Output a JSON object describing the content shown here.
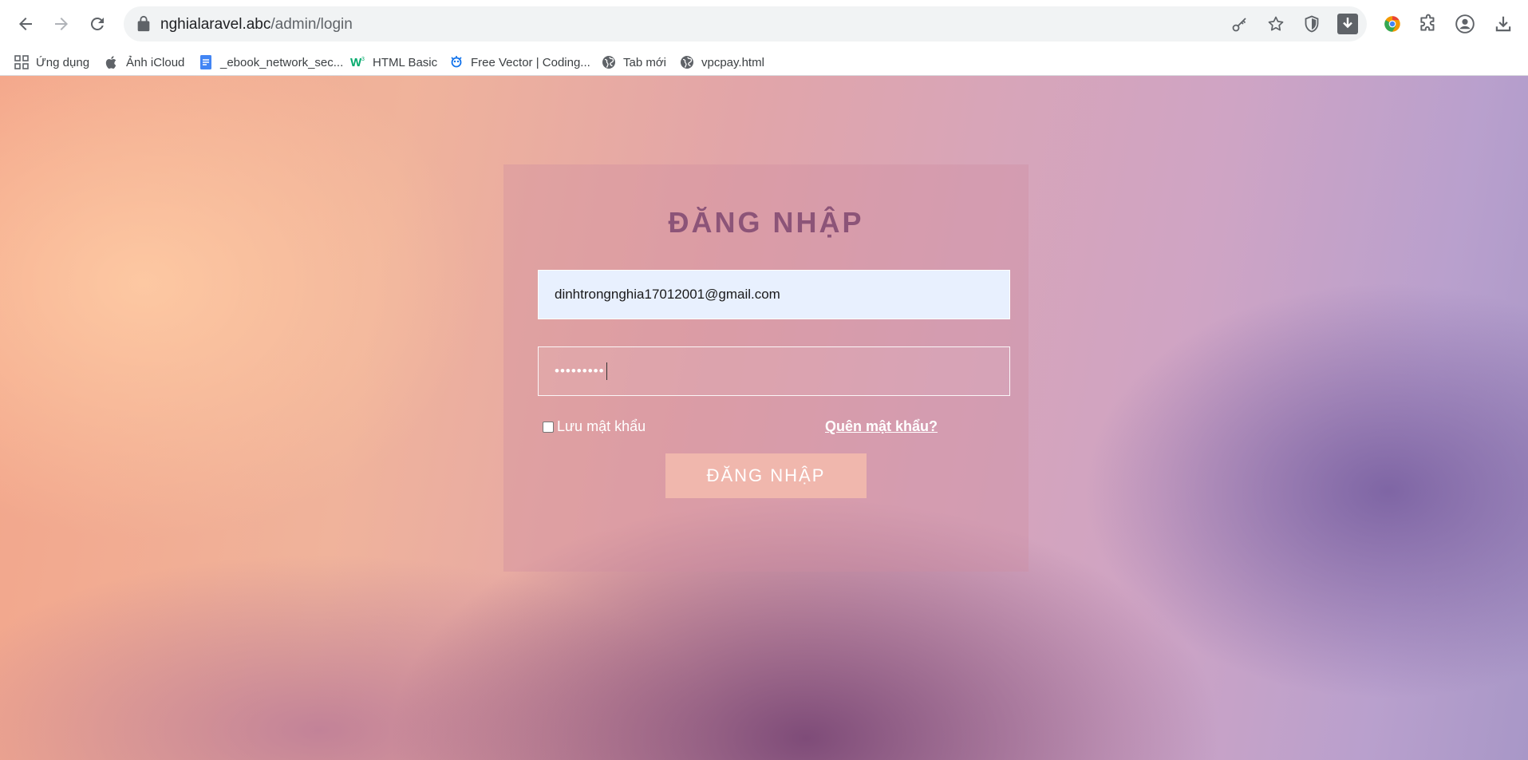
{
  "browser": {
    "url_host": "nghialaravel.abc",
    "url_path": "/admin/login"
  },
  "bookmarks": [
    {
      "label": "Ứng dụng"
    },
    {
      "label": "Ảnh iCloud"
    },
    {
      "label": "_ebook_network_sec..."
    },
    {
      "label": "HTML Basic"
    },
    {
      "label": "Free Vector | Coding..."
    },
    {
      "label": "Tab mới"
    },
    {
      "label": "vpcpay.html"
    }
  ],
  "login": {
    "title": "ĐĂNG NHẬP",
    "email_value": "dinhtrongnghia17012001@gmail.com",
    "password_mask": "•••••••••",
    "remember_label": "Lưu mật khẩu",
    "forgot_label": "Quên mật khẩu?",
    "submit_label": "ĐĂNG NHẬP"
  },
  "colors": {
    "title": "#8c5478",
    "submit_bg": "#f0b7ad",
    "email_bg": "#e8f0fe"
  }
}
